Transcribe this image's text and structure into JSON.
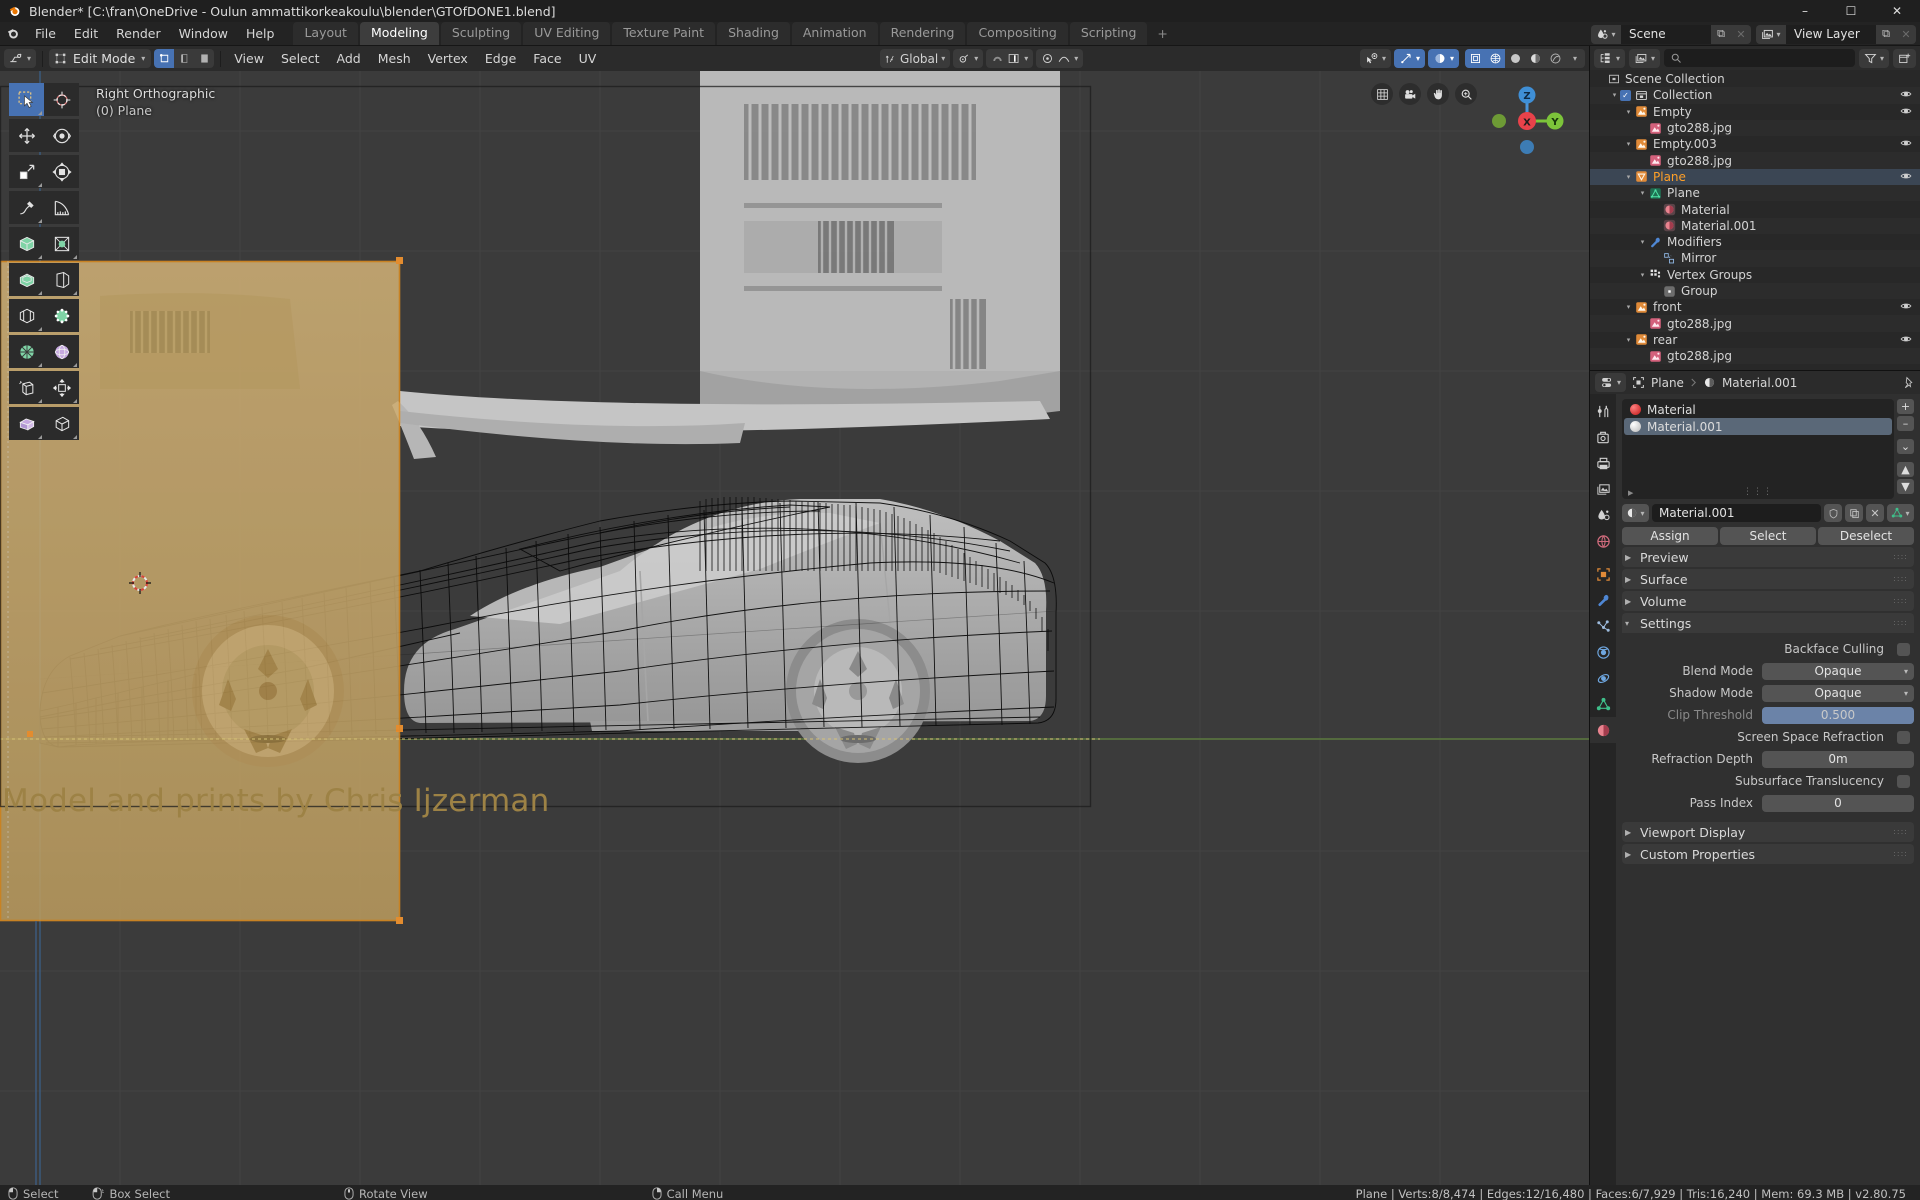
{
  "window": {
    "title": "Blender* [C:\\fran\\OneDrive - Oulun ammattikorkeakoulu\\blender\\GTOfDONE1.blend]",
    "minimize": "–",
    "maximize": "☐",
    "close": "✕"
  },
  "topbar": {
    "menus": [
      "File",
      "Edit",
      "Render",
      "Window",
      "Help"
    ],
    "tabs": [
      {
        "label": "Layout",
        "active": false
      },
      {
        "label": "Modeling",
        "active": true
      },
      {
        "label": "Sculpting",
        "active": false
      },
      {
        "label": "UV Editing",
        "active": false
      },
      {
        "label": "Texture Paint",
        "active": false
      },
      {
        "label": "Shading",
        "active": false
      },
      {
        "label": "Animation",
        "active": false
      },
      {
        "label": "Rendering",
        "active": false
      },
      {
        "label": "Compositing",
        "active": false
      },
      {
        "label": "Scripting",
        "active": false
      }
    ],
    "add_tab": "+",
    "scene": {
      "name": "Scene",
      "new_btn": "⧉",
      "unlink_btn": "✕"
    },
    "view_layer": {
      "name": "View Layer",
      "new_btn": "⧉",
      "unlink_btn": "✕"
    }
  },
  "viewport": {
    "mode": "Edit Mode",
    "menus": [
      "View",
      "Select",
      "Add",
      "Mesh",
      "Vertex",
      "Edge",
      "Face",
      "UV"
    ],
    "transform_orientation": "Global",
    "overlay_line1": "Right Orthographic",
    "overlay_line2": "(0) Plane",
    "watermark": "Model and prints by Chris Ijzerman",
    "gizmo_axes": [
      "X",
      "Y",
      "Z"
    ],
    "tools": [
      "tweak-select-tool",
      "cursor-tool",
      "move-tool",
      "rotate-tool",
      "scale-tool",
      "transform-tool",
      "annotate-tool",
      "measure-tool",
      "add-cube-tool",
      "extrude-region-tool",
      "inset-faces-tool",
      "bevel-tool",
      "loop-cut-tool",
      "knife-tool",
      "poly-build-tool",
      "spin-tool",
      "smooth-tool",
      "edge-slide-tool",
      "shrink-fatten-tool",
      "shear-tool"
    ],
    "nav_buttons": [
      "grid-icon",
      "camera-icon",
      "hand-icon",
      "zoom-icon"
    ]
  },
  "outliner": {
    "search_placeholder": "",
    "rows": [
      {
        "indent": 0,
        "tri": "",
        "icon": "scene-collection",
        "label": "Scene Collection",
        "eye": false,
        "check": false,
        "selected": false
      },
      {
        "indent": 1,
        "tri": "▾",
        "icon": "collection",
        "label": "Collection",
        "eye": true,
        "check": true,
        "selected": false
      },
      {
        "indent": 2,
        "tri": "▾",
        "icon": "image-empty",
        "label": "Empty",
        "eye": true,
        "check": false,
        "selected": false
      },
      {
        "indent": 3,
        "tri": "",
        "icon": "image-data",
        "label": "gto288.jpg",
        "eye": false,
        "check": false,
        "selected": false
      },
      {
        "indent": 2,
        "tri": "▾",
        "icon": "image-empty",
        "label": "Empty.003",
        "eye": true,
        "check": false,
        "selected": false
      },
      {
        "indent": 3,
        "tri": "",
        "icon": "image-data",
        "label": "gto288.jpg",
        "eye": false,
        "check": false,
        "selected": false
      },
      {
        "indent": 2,
        "tri": "▾",
        "icon": "mesh-object",
        "label": "Plane",
        "eye": true,
        "check": false,
        "selected": true
      },
      {
        "indent": 3,
        "tri": "▾",
        "icon": "mesh-data",
        "label": "Plane",
        "eye": false,
        "check": false,
        "selected": false
      },
      {
        "indent": 4,
        "tri": "",
        "icon": "material",
        "label": "Material",
        "eye": false,
        "check": false,
        "selected": false
      },
      {
        "indent": 4,
        "tri": "",
        "icon": "material",
        "label": "Material.001",
        "eye": false,
        "check": false,
        "selected": false
      },
      {
        "indent": 3,
        "tri": "▾",
        "icon": "modifier",
        "label": "Modifiers",
        "eye": false,
        "check": false,
        "selected": false
      },
      {
        "indent": 4,
        "tri": "",
        "icon": "mirror-modifier",
        "label": "Mirror",
        "eye": false,
        "check": false,
        "selected": false
      },
      {
        "indent": 3,
        "tri": "▾",
        "icon": "vertex-group",
        "label": "Vertex Groups",
        "eye": false,
        "check": false,
        "selected": false
      },
      {
        "indent": 4,
        "tri": "",
        "icon": "group",
        "label": "Group",
        "eye": false,
        "check": false,
        "selected": false
      },
      {
        "indent": 2,
        "tri": "▾",
        "icon": "image-empty",
        "label": "front",
        "eye": true,
        "check": false,
        "selected": false
      },
      {
        "indent": 3,
        "tri": "",
        "icon": "image-data",
        "label": "gto288.jpg",
        "eye": false,
        "check": false,
        "selected": false
      },
      {
        "indent": 2,
        "tri": "▾",
        "icon": "image-empty",
        "label": "rear",
        "eye": true,
        "check": false,
        "selected": false
      },
      {
        "indent": 3,
        "tri": "",
        "icon": "image-data",
        "label": "gto288.jpg",
        "eye": false,
        "check": false,
        "selected": false
      }
    ]
  },
  "properties": {
    "breadcrumb_object": "Plane",
    "breadcrumb_material": "Material.001",
    "tabs": [
      "tool-tab",
      "render-tab",
      "output-tab",
      "view-layer-tab",
      "scene-tab",
      "world-tab",
      "object-tab",
      "modifier-tab",
      "particles-tab",
      "physics-tab",
      "constraints-tab",
      "data-tab",
      "material-tab"
    ],
    "material_slots": [
      {
        "name": "Material",
        "color": "#e02020",
        "selected": false
      },
      {
        "name": "Material.001",
        "color": "#d8d8d8",
        "selected": true
      }
    ],
    "slot_buttons": [
      "+",
      "–",
      "⌄",
      "▲",
      "▼"
    ],
    "material_name": "Material.001",
    "name_row_buttons": [
      "shield-icon",
      "copy-icon",
      "x-icon"
    ],
    "assign_label": "Assign",
    "select_label": "Select",
    "deselect_label": "Deselect",
    "panels": [
      {
        "label": "Preview",
        "open": false
      },
      {
        "label": "Surface",
        "open": false
      },
      {
        "label": "Volume",
        "open": false
      },
      {
        "label": "Settings",
        "open": true
      }
    ],
    "settings": [
      {
        "label": "Backface Culling",
        "type": "checkbox",
        "value": "",
        "checked": false,
        "dim": false
      },
      {
        "label": "Blend Mode",
        "type": "dropdown",
        "value": "Opaque",
        "dim": false
      },
      {
        "label": "Shadow Mode",
        "type": "dropdown",
        "value": "Opaque",
        "dim": false
      },
      {
        "label": "Clip Threshold",
        "type": "slider",
        "value": "0.500",
        "dim": true
      },
      {
        "label": "Screen Space Refraction",
        "type": "checkbox",
        "value": "",
        "checked": false,
        "dim": false
      },
      {
        "label": "Refraction Depth",
        "type": "field",
        "value": "0m",
        "dim": false
      },
      {
        "label": "Subsurface Translucency",
        "type": "checkbox",
        "value": "",
        "checked": false,
        "dim": false
      },
      {
        "label": "Pass Index",
        "type": "field",
        "value": "0",
        "dim": false
      }
    ],
    "bottom_panels": [
      {
        "label": "Viewport Display",
        "open": false
      },
      {
        "label": "Custom Properties",
        "open": false
      }
    ]
  },
  "status": {
    "hints": [
      {
        "icon": "mouse-left-icon",
        "label": "Select"
      },
      {
        "icon": "mouse-drag-icon",
        "label": "Box Select"
      },
      {
        "icon": "mouse-middle-icon",
        "label": "Rotate View"
      },
      {
        "icon": "mouse-right-icon",
        "label": "Call Menu"
      }
    ],
    "stats": "Plane | Verts:8/8,474 | Edges:12/16,480 | Faces:6/7,929 | Tris:16,240 | Mem: 69.3 MB | v2.80.75"
  },
  "colors": {
    "accent_blue": "#4772b3",
    "orange_select": "#ffa028",
    "backdrop_tan": "#c8a96b",
    "viewport_bg": "#3b3b3b"
  }
}
